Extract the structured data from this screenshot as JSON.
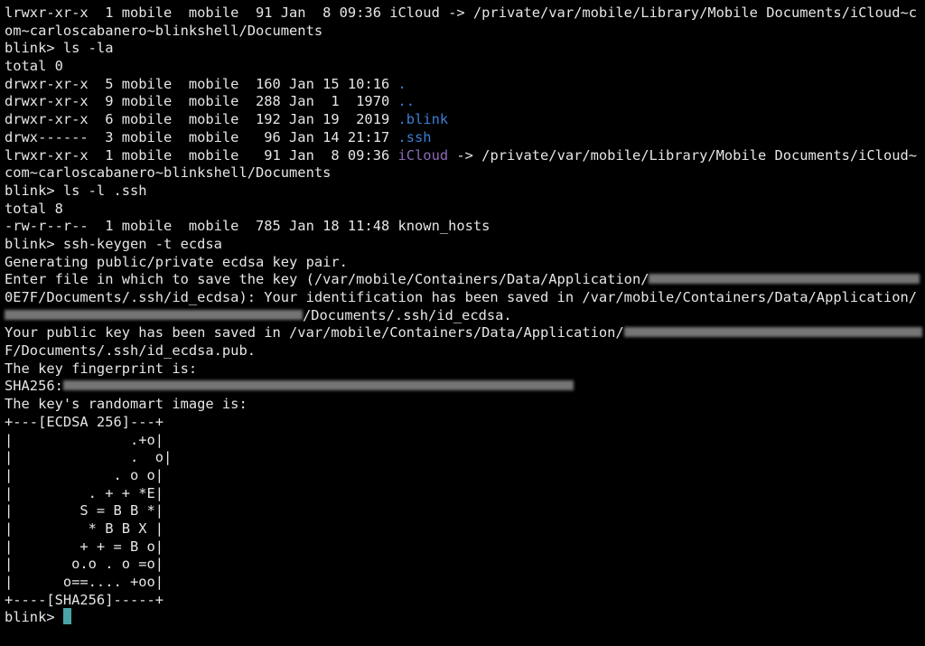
{
  "terminal": {
    "lines": [
      {
        "text": "lrwxr-xr-x  1 mobile  mobile  91 Jan  8 09:36 iCloud -> /private/var/mobile/Library/Mobile Documents/iCloud~c"
      },
      {
        "text": "om~carloscabanero~blinkshell/Documents"
      },
      {
        "text": "blink> ls -la"
      },
      {
        "text": "total 0"
      },
      {
        "prefix": "drwxr-xr-x  5 mobile  mobile  160 Jan 15 10:16 ",
        "name": "."
      },
      {
        "prefix": "drwxr-xr-x  9 mobile  mobile  288 Jan  1  1970 ",
        "name": ".."
      },
      {
        "prefix": "drwxr-xr-x  6 mobile  mobile  192 Jan 19  2019 ",
        "name": ".blink"
      },
      {
        "prefix": "drwx------  3 mobile  mobile   96 Jan 14 21:17 ",
        "name": ".ssh"
      },
      {
        "prefix": "lrwxr-xr-x  1 mobile  mobile   91 Jan  8 09:36 ",
        "name": "iCloud",
        "suffix": " -> /private/var/mobile/Library/Mobile Documents/iCloud~"
      },
      {
        "text": "com~carloscabanero~blinkshell/Documents"
      },
      {
        "text": "blink> ls -l .ssh"
      },
      {
        "text": "total 8"
      },
      {
        "text": "-rw-r--r--  1 mobile  mobile  785 Jan 18 11:48 known_hosts"
      },
      {
        "text": "blink> ssh-keygen -t ecdsa"
      },
      {
        "text": "Generating public/private ecdsa key pair."
      },
      {
        "text": "Enter file in which to save the key (/var/mobile/Containers/Data/Application/"
      },
      {
        "text": "0E7F/Documents/.ssh/id_ecdsa): Your identification has been saved in /var/mobile/Containers/Data/Application/"
      },
      {
        "text": "/Documents/.ssh/id_ecdsa."
      },
      {
        "text": "Your public key has been saved in /var/mobile/Containers/Data/Application/"
      },
      {
        "text": "F/Documents/.ssh/id_ecdsa.pub."
      },
      {
        "text": "The key fingerprint is:"
      },
      {
        "text": "SHA256:"
      },
      {
        "text": "The key's randomart image is:"
      },
      {
        "text": "+---[ECDSA 256]---+"
      },
      {
        "text": "|              .+o|"
      },
      {
        "text": "|              .  o|"
      },
      {
        "text": "|            . o o|"
      },
      {
        "text": "|         . + + *E|"
      },
      {
        "text": "|        S = B B *|"
      },
      {
        "text": "|         * B B X |"
      },
      {
        "text": "|        + + = B o|"
      },
      {
        "text": "|       o.o . o =o|"
      },
      {
        "text": "|      o==.... +oo|"
      },
      {
        "text": "+----[SHA256]-----+"
      }
    ],
    "prompt": "blink> ",
    "colors": {
      "background": "#000000",
      "text": "#e6e6e6",
      "dir_link": "#3b7fd6",
      "symlink": "#8c6bb5",
      "cursor": "#4aa3a8"
    }
  }
}
